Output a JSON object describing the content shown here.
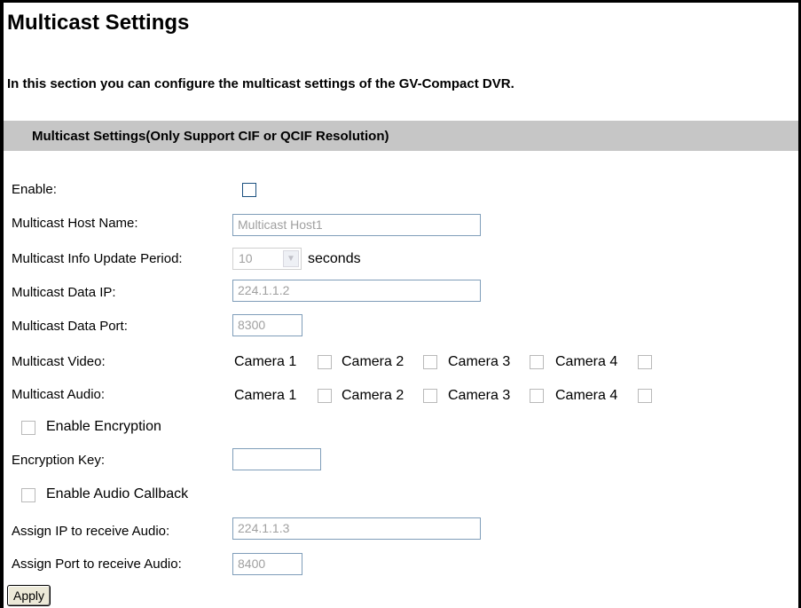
{
  "page": {
    "title": "Multicast Settings",
    "description": "In this section you can configure the multicast settings of the GV-Compact DVR."
  },
  "section": {
    "title": "Multicast Settings(Only Support CIF or QCIF Resolution)"
  },
  "form": {
    "enable_label": "Enable:",
    "enable_checked": false,
    "host_name_label": "Multicast Host Name:",
    "host_name_value": "Multicast Host1",
    "update_period_label": "Multicast Info Update Period:",
    "update_period_value": "10",
    "update_period_unit": "seconds",
    "data_ip_label": "Multicast Data IP:",
    "data_ip_value": "224.1.1.2",
    "data_port_label": "Multicast Data Port:",
    "data_port_value": "8300",
    "video_label": "Multicast Video:",
    "audio_label": "Multicast Audio:",
    "cameras": [
      "Camera 1",
      "Camera 2",
      "Camera 3",
      "Camera 4"
    ],
    "enable_encryption_label": "Enable Encryption",
    "encryption_key_label": "Encryption Key:",
    "encryption_key_value": "",
    "enable_audio_callback_label": "Enable Audio Callback",
    "audio_ip_label": "Assign IP to receive Audio:",
    "audio_ip_value": "224.1.1.3",
    "audio_port_label": "Assign Port to receive Audio:",
    "audio_port_value": "8400"
  },
  "buttons": {
    "apply_label": "Apply"
  },
  "colors": {
    "section_header_bg": "#c6c6c6",
    "input_border": "#7f9db9",
    "disabled_text": "#a0a0a0"
  }
}
